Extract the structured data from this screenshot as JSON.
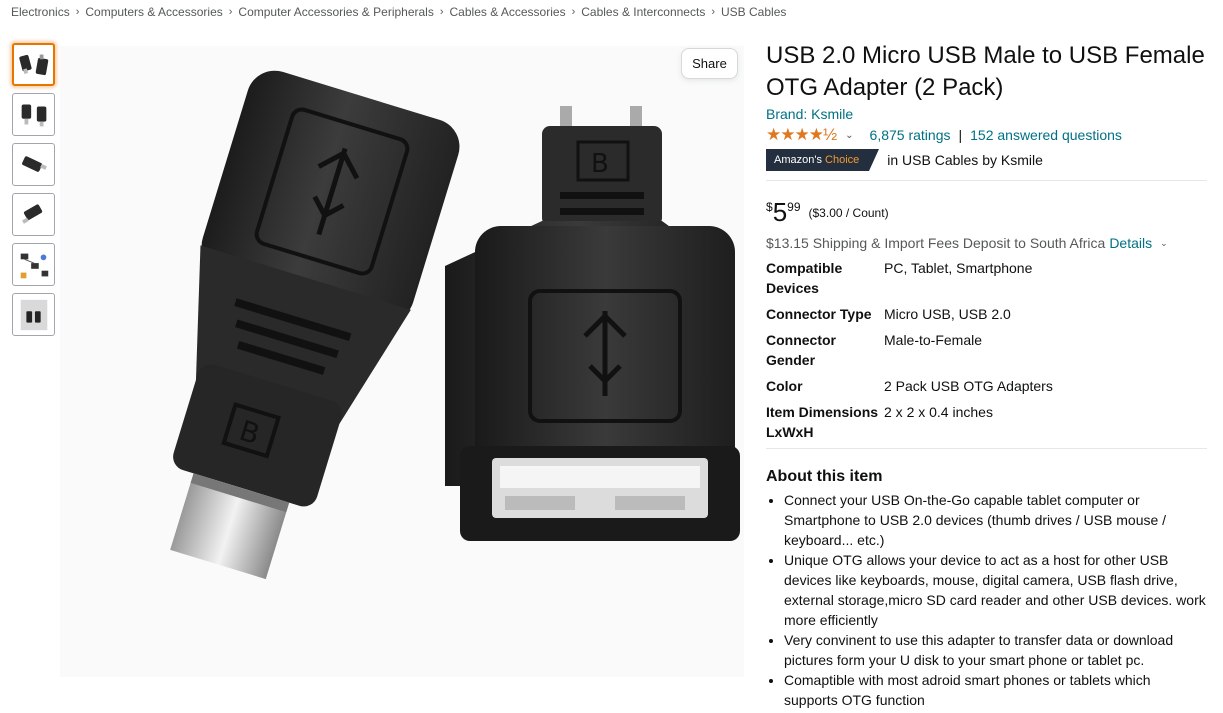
{
  "breadcrumb": [
    "Electronics",
    "Computers & Accessories",
    "Computer Accessories & Peripherals",
    "Cables & Accessories",
    "Cables & Interconnects",
    "USB Cables"
  ],
  "breadcrumb_separator": "›",
  "share_label": "Share",
  "product": {
    "title": "USB 2.0 Micro USB Male to USB Female OTG Adapter (2 Pack)",
    "brand": "Brand: Ksmile",
    "stars": "★★★★½",
    "rating": 4.5,
    "ratings_count": "6,875 ratings",
    "answered": "152 answered questions",
    "choice_badge_prefix": "Amazon's",
    "choice_badge_suffix": "Choice",
    "choice_text": "in USB Cables by Ksmile",
    "price_symbol": "$",
    "price_whole": "5",
    "price_fraction": "99",
    "unit_price": "($3.00 / Count)",
    "shipping_text": "$13.15 Shipping & Import Fees Deposit to South Africa",
    "details_link": "Details"
  },
  "specs": [
    {
      "label": "Compatible Devices",
      "value": "PC, Tablet, Smartphone"
    },
    {
      "label": "Connector Type",
      "value": "Micro USB, USB 2.0"
    },
    {
      "label": "Connector Gender",
      "value": "Male-to-Female"
    },
    {
      "label": "Color",
      "value": "2 Pack USB OTG Adapters"
    },
    {
      "label": "Item Dimensions LxWxH",
      "value": "2 x 2 x 0.4 inches"
    }
  ],
  "about": {
    "title": "About this item",
    "bullets": [
      "Connect your USB On-the-Go capable tablet computer or Smartphone to USB 2.0 devices (thumb drives / USB mouse / keyboard... etc.)",
      "Unique OTG allows your device to act as a host for other USB devices like keyboards, mouse, digital camera, USB flash drive, external storage,micro SD card reader and other USB devices. work more efficiently",
      "Very convinent to use this adapter to transfer data or download pictures form your U disk to your smart phone or tablet pc.",
      "Comaptible with most adroid smart phones or tablets which supports OTG function"
    ]
  },
  "colors": {
    "link": "#007185",
    "star": "#de7921",
    "badge_bg": "#232f3e",
    "badge_accent": "#f69931",
    "thumb_active": "#e77600"
  },
  "icons": [
    "chevron-right-icon",
    "chevron-down-icon",
    "star-icon"
  ]
}
